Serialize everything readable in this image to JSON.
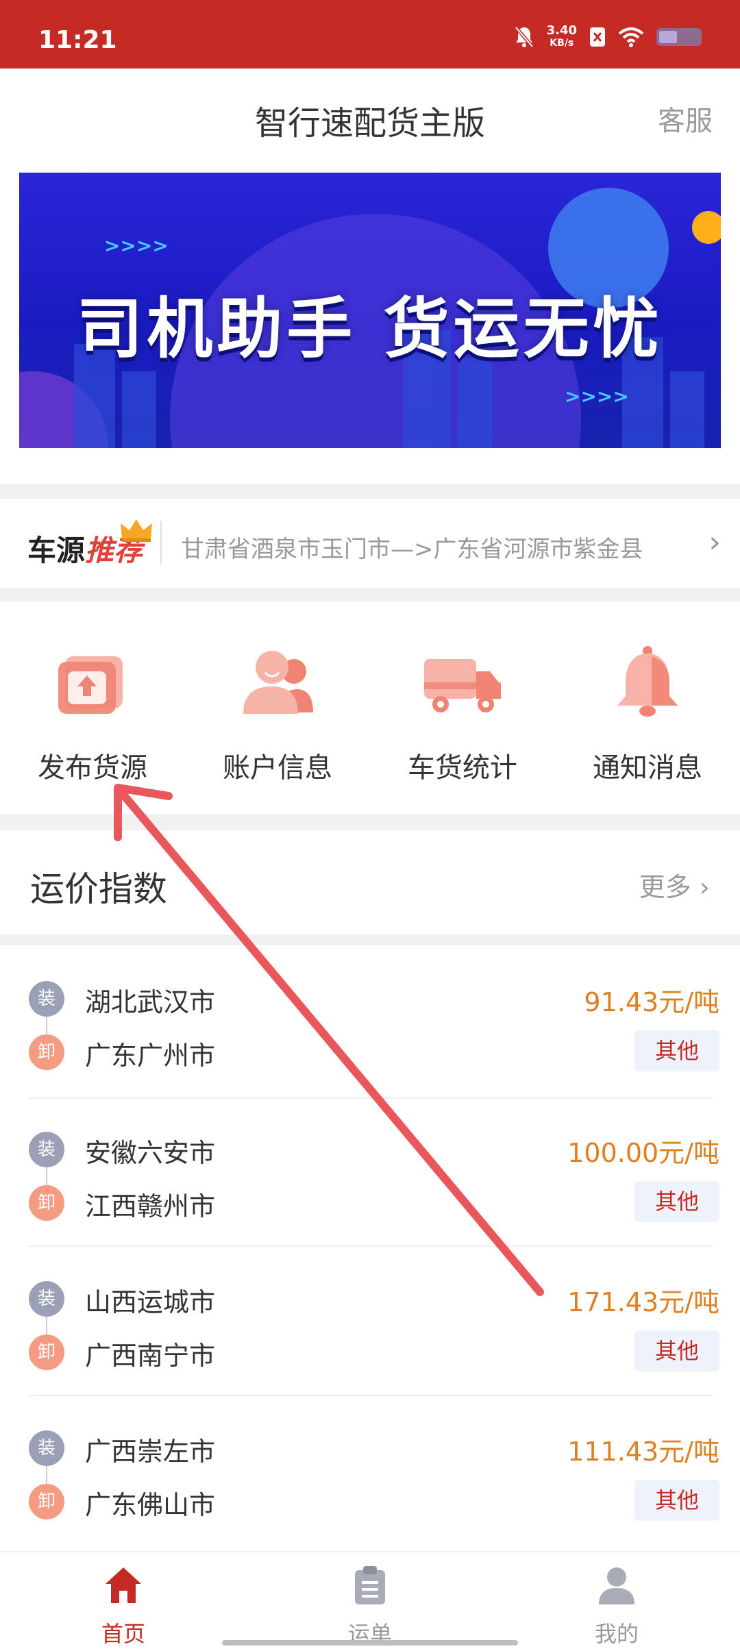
{
  "status_bar": {
    "time": "11:21",
    "net_speed_value": "3.40",
    "net_speed_unit": "KB/s",
    "icons": [
      "bell-off-icon",
      "net-speed-icon",
      "sim-x-icon",
      "wifi-icon",
      "battery-icon"
    ]
  },
  "header": {
    "title": "智行速配货主版",
    "service_label": "客服"
  },
  "banner": {
    "text": "司机助手  货运无忧",
    "colors": {
      "bg_top": "#2a25d6",
      "bg_bottom": "#1822ad",
      "circle": "#5a5ae8",
      "accent": "#ffb019"
    }
  },
  "recommend": {
    "label_part1": "车源",
    "label_part2": "推荐",
    "route": "甘肃省酒泉市玉门市—>广东省河源市紫金县",
    "icons": [
      "crown-icon",
      "chevron-right-icon"
    ]
  },
  "quick_actions": [
    {
      "label": "发布货源",
      "icon": "publish-upload-icon"
    },
    {
      "label": "账户信息",
      "icon": "account-user-icon"
    },
    {
      "label": "车货统计",
      "icon": "truck-icon"
    },
    {
      "label": "通知消息",
      "icon": "bell-icon"
    }
  ],
  "price_index": {
    "title": "运价指数",
    "more_label": "更多",
    "load_badge": "装",
    "unload_badge": "卸",
    "rows": [
      {
        "from": "湖北武汉市",
        "to": "广东广州市",
        "price": "91.43元/吨",
        "tag": "其他"
      },
      {
        "from": "安徽六安市",
        "to": "江西赣州市",
        "price": "100.00元/吨",
        "tag": "其他"
      },
      {
        "from": "山西运城市",
        "to": "广西南宁市",
        "price": "171.43元/吨",
        "tag": "其他"
      },
      {
        "from": "广西崇左市",
        "to": "广东佛山市",
        "price": "111.43元/吨",
        "tag": "其他"
      }
    ]
  },
  "tab_bar": {
    "tabs": [
      {
        "label": "首页",
        "icon": "home-icon",
        "active": true
      },
      {
        "label": "运单",
        "icon": "clipboard-icon",
        "active": false
      },
      {
        "label": "我的",
        "icon": "person-icon",
        "active": false
      }
    ]
  },
  "colors": {
    "primary_red": "#c62a24",
    "price_orange": "#e07f1f",
    "annotation_arrow": "#e9575b"
  }
}
